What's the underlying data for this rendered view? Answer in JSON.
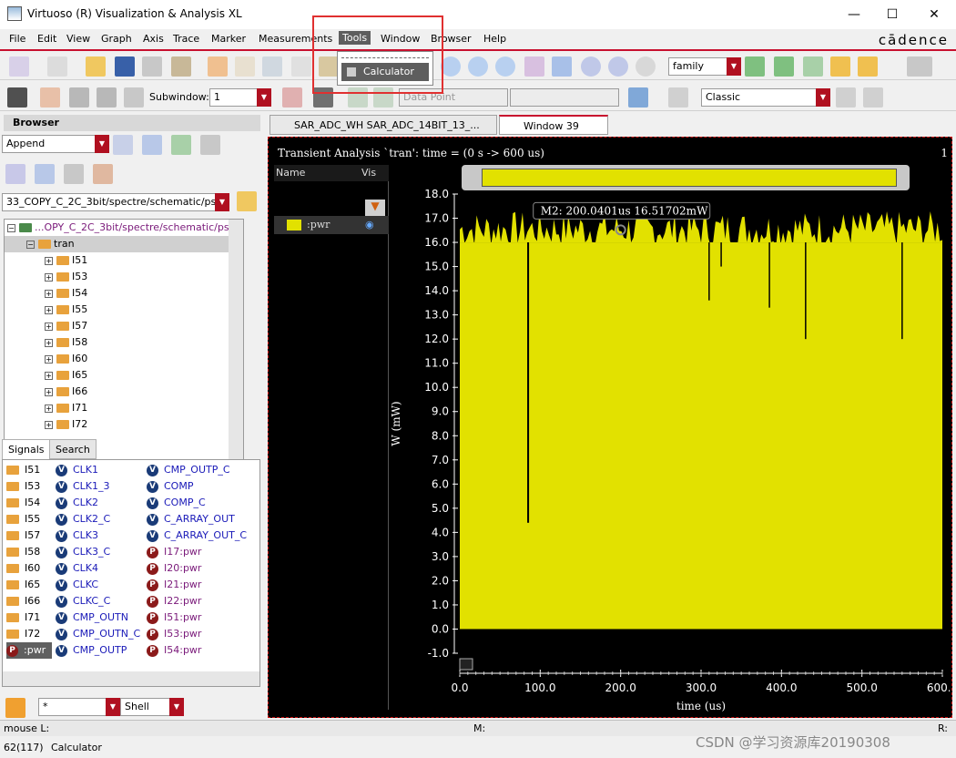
{
  "window": {
    "title": "Virtuoso (R) Visualization & Analysis XL",
    "minimize": "—",
    "maximize": "☐",
    "close": "✕"
  },
  "menu": {
    "items": [
      "File",
      "Edit",
      "View",
      "Graph",
      "Axis",
      "Trace",
      "Marker",
      "Measurements",
      "Tools",
      "Window",
      "Browser",
      "Help"
    ],
    "active": "Tools",
    "brand": "cādence"
  },
  "tools_menu": {
    "items": [
      "Calculator"
    ]
  },
  "toolbar": {
    "family_select": "family",
    "subwindow_label": "Subwindow:",
    "subwindow_value": "1",
    "data_point_select": "Data Point",
    "classic_select": "Classic"
  },
  "browser": {
    "title": "Browser",
    "append_select": "Append",
    "path_select": "33_COPY_C_2C_3bit/spectre/schematic/psf",
    "tree_root": "...OPY_C_2C_3bit/spectre/schematic/psf",
    "tree_tran": "tran",
    "tree_items": [
      "I51",
      "I53",
      "I54",
      "I55",
      "I57",
      "I58",
      "I60",
      "I65",
      "I66",
      "I71",
      "I72"
    ],
    "tabs": [
      "Signals",
      "Search"
    ],
    "signals_col1": [
      "I51",
      "I53",
      "I54",
      "I55",
      "I57",
      "I58",
      "I60",
      "I65",
      "I66",
      "I71",
      "I72",
      ":pwr"
    ],
    "signals_col2": [
      "CLK1",
      "CLK1_3",
      "CLK2",
      "CLK2_C",
      "CLK3",
      "CLK3_C",
      "CLK4",
      "CLKC",
      "CLKC_C",
      "CMP_OUTN",
      "CMP_OUTN_C",
      "CMP_OUTP"
    ],
    "signals_col3": [
      "CMP_OUTP_C",
      "COMP",
      "COMP_C",
      "C_ARRAY_OUT",
      "C_ARRAY_OUT_C",
      "I17:pwr",
      "I20:pwr",
      "I21:pwr",
      "I22:pwr",
      "I51:pwr",
      "I53:pwr",
      "I54:pwr"
    ],
    "filter_value": "*",
    "shell_select": "Shell"
  },
  "window_tabs": [
    "SAR_ADC_WH SAR_ADC_14BIT_13_...",
    "Window 39"
  ],
  "plot": {
    "header": "Transient Analysis `tran': time = (0 s -> 600 us)",
    "subwindow_num": "1",
    "legend_cols": [
      "Name",
      "Vis"
    ],
    "legend_trace": ":pwr",
    "marker_label": "M2: 200.0401us 16.51702mW",
    "trace_color": "#e2e100"
  },
  "chart_data": {
    "type": "area",
    "title": "Transient Analysis `tran': time = (0 s -> 600 us)",
    "xlabel": "time (us)",
    "ylabel": "W (mW)",
    "xlim": [
      0,
      600
    ],
    "ylim": [
      -1.0,
      18.0
    ],
    "x_ticks": [
      "0.0",
      "100.0",
      "200.0",
      "300.0",
      "400.0",
      "500.0",
      "600.0"
    ],
    "y_ticks": [
      "18.0",
      "17.0",
      "16.0",
      "15.0",
      "14.0",
      "13.0",
      "12.0",
      "11.0",
      "10.0",
      "9.0",
      "8.0",
      "7.0",
      "6.0",
      "5.0",
      "4.0",
      "3.0",
      "2.0",
      "1.0",
      "0.0",
      "-1.0"
    ],
    "series": [
      {
        "name": ":pwr",
        "x": [
          0,
          85,
          200.04,
          310,
          325,
          385,
          430,
          550,
          600
        ],
        "y": [
          16.5,
          4.4,
          16.52,
          13.6,
          15.0,
          13.3,
          12.0,
          12.0,
          16.5
        ]
      }
    ],
    "band_upper_range": [
      15.8,
      17.3
    ],
    "marker": {
      "x": 200.0401,
      "y": 16.51702,
      "label": "M2: 200.0401us 16.51702mW"
    }
  },
  "status": {
    "mouse_label": "mouse L:",
    "m_label": "M:",
    "r_label": "R:",
    "line_count": "62(117)",
    "command": "Calculator",
    "watermark": "CSDN @学习资源库20190308"
  }
}
